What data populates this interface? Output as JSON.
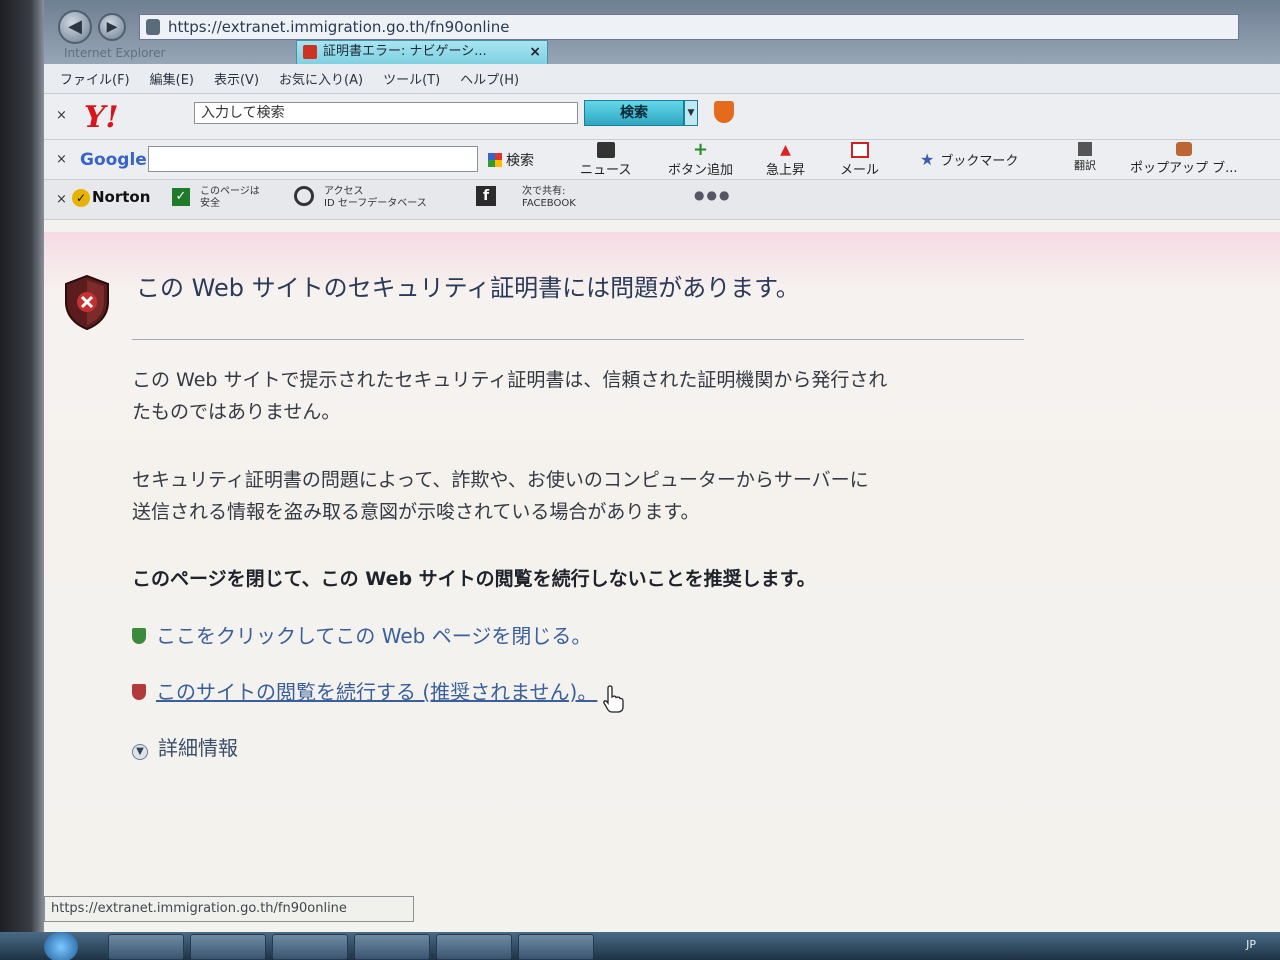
{
  "browser": {
    "address_url": "https://extranet.immigration.go.th/fn90online",
    "tab_title": "証明書エラー: ナビゲーシ...",
    "tab_close": "×",
    "window_title": "Internet Explorer"
  },
  "menu": [
    "ファイル(F)",
    "編集(E)",
    "表示(V)",
    "お気に入り(A)",
    "ツール(T)",
    "ヘルプ(H)"
  ],
  "yahoo_toolbar": {
    "close": "×",
    "logo": "Y!",
    "search_placeholder": "入力して検索",
    "search_button": "検索"
  },
  "google_toolbar": {
    "close": "×",
    "logo": "Google",
    "search_button": "検索",
    "items": [
      "ニュース",
      "ボタン追加",
      "急上昇",
      "メール",
      "ブックマーク",
      "翻訳",
      "ポップアップ ブ..."
    ]
  },
  "norton_toolbar": {
    "close": "×",
    "logo": "Norton",
    "page_safe_line1": "このページは",
    "page_safe_line2": "安全",
    "access_line1": "アクセス",
    "access_line2": "ID セーフデータベース",
    "share_line1": "次で共有:",
    "share_line2": "FACEBOOK",
    "more": "●●●"
  },
  "page": {
    "heading": "この Web サイトのセキュリティ証明書には問題があります。",
    "para1_line1": "この Web サイトで提示されたセキュリティ証明書は、信頼された証明機関から発行され",
    "para1_line2": "たものではありません。",
    "para2_line1": "セキュリティ証明書の問題によって、詐欺や、お使いのコンピューターからサーバーに",
    "para2_line2": "送信される情報を盗み取る意図が示唆されている場合があります。",
    "recommend": "このページを閉じて、この Web サイトの閲覧を続行しないことを推奨します。",
    "link_close": "ここをクリックしてこの Web ページを閉じる。",
    "link_continue": "このサイトの閲覧を続行する (推奨されません)。",
    "more_info": "詳細情報"
  },
  "status_bar": "https://extranet.immigration.go.th/fn90online",
  "taskbar": {
    "lang": "JP"
  }
}
